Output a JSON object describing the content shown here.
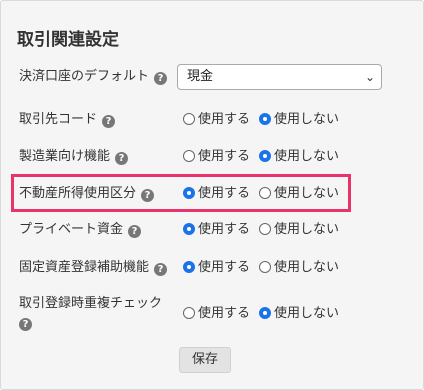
{
  "settings": {
    "title": "取引関連設定",
    "default_payment": {
      "label": "決済口座のデフォルト",
      "selected": "現金"
    },
    "rows": [
      {
        "label": "取引先コード",
        "use": "使用する",
        "nouse": "使用しない",
        "selected": "nouse"
      },
      {
        "label": "製造業向け機能",
        "use": "使用する",
        "nouse": "使用しない",
        "selected": "nouse"
      },
      {
        "label": "不動産所得使用区分",
        "use": "使用する",
        "nouse": "使用しない",
        "selected": "use"
      },
      {
        "label": "プライベート資金",
        "use": "使用する",
        "nouse": "使用しない",
        "selected": "use"
      },
      {
        "label": "固定資産登録補助機能",
        "use": "使用する",
        "nouse": "使用しない",
        "selected": "use"
      },
      {
        "label": "取引登録時重複チェック",
        "use": "使用する",
        "nouse": "使用しない",
        "selected": "nouse"
      }
    ],
    "help_glyph": "?",
    "save_label": "保存"
  },
  "colors": {
    "highlight": "#e9336b",
    "radio_selected": "#1a73e8"
  }
}
